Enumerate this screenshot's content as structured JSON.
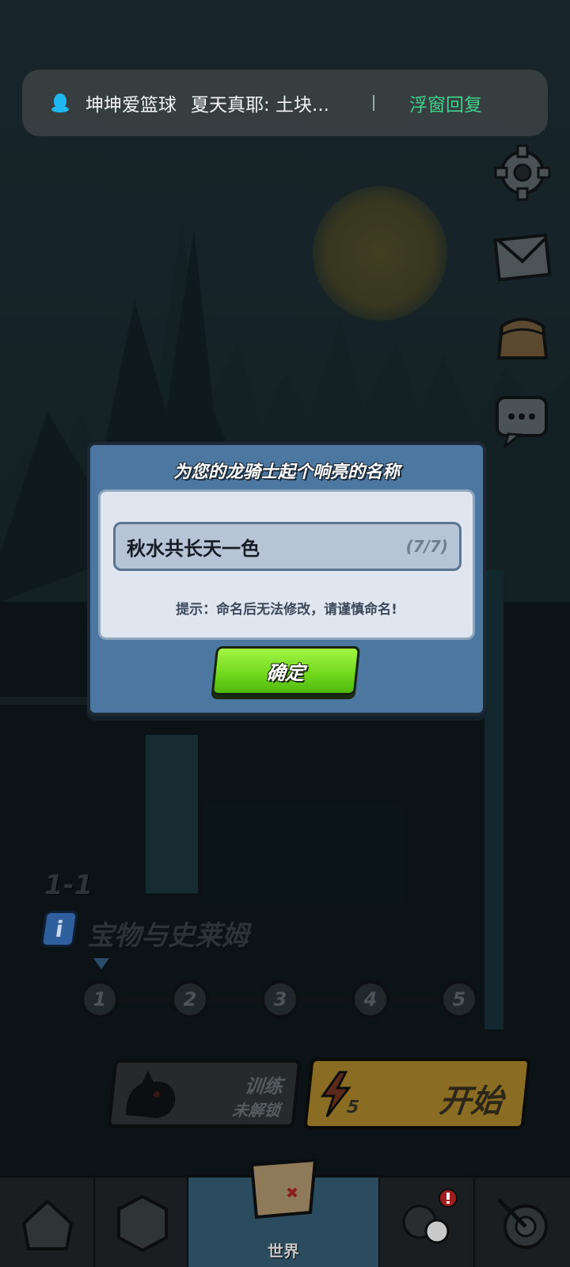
{
  "notification": {
    "sender": "坤坤爱篮球",
    "message": "夏天真耶: 土块...",
    "action": "浮窗回复"
  },
  "dialog": {
    "title": "为您的龙骑士起个响亮的名称",
    "name_value": "秋水共长天一色",
    "char_count": "(7/7)",
    "hint": "提示：命名后无法修改，请谨慎命名!",
    "confirm_label": "确定"
  },
  "stage": {
    "number": "1-1",
    "name": "宝物与史莱姆",
    "info_icon": "i",
    "nodes": [
      "1",
      "2",
      "3",
      "4",
      "5"
    ]
  },
  "actions": {
    "train_title": "训练",
    "train_status": "未解锁",
    "start_energy": "5",
    "start_label": "开始"
  },
  "bottom_nav": {
    "active_label": "世界"
  },
  "colors": {
    "dialog_bg": "#4c77a0",
    "confirm_green": "#7ad926",
    "notification_action": "#3fd18a"
  }
}
